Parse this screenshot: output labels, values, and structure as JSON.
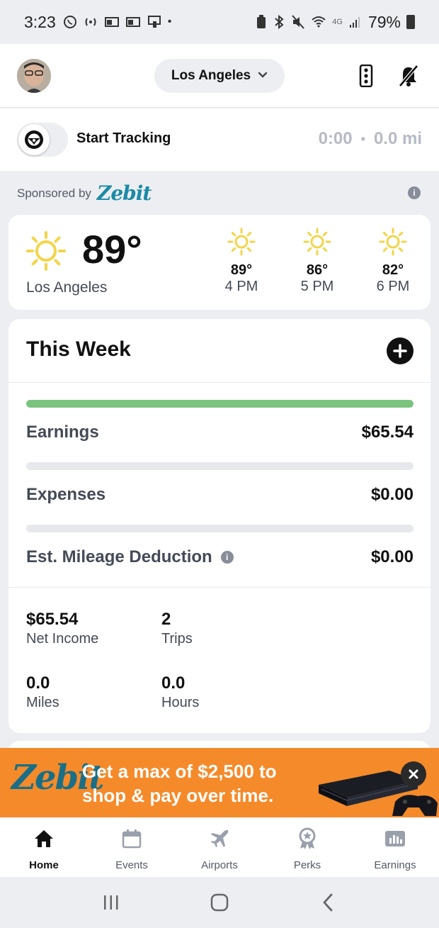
{
  "status_bar": {
    "time": "3:23",
    "network": "4G",
    "battery": "79%"
  },
  "header": {
    "city": "Los Angeles"
  },
  "tracking": {
    "label": "Start Tracking",
    "duration": "0:00",
    "separator": "•",
    "distance": "0.0 mi"
  },
  "sponsor": {
    "label": "Sponsored by",
    "brand": "Zebit"
  },
  "weather": {
    "current_temp": "89°",
    "city": "Los Angeles",
    "forecast": [
      {
        "temp": "89°",
        "hour": "4 PM"
      },
      {
        "temp": "86°",
        "hour": "5 PM"
      },
      {
        "temp": "82°",
        "hour": "6 PM"
      }
    ],
    "sun_color": "#f2d54a"
  },
  "this_week": {
    "title": "This Week",
    "earnings_progress": 1.0,
    "expenses_progress": 0,
    "mileage_progress": 0,
    "rows": {
      "earnings_label": "Earnings",
      "earnings_value": "$65.54",
      "expenses_label": "Expenses",
      "expenses_value": "$0.00",
      "mileage_label": "Est. Mileage Deduction",
      "mileage_value": "$0.00"
    },
    "stats": {
      "net_income_value": "$65.54",
      "net_income_label": "Net Income",
      "trips_value": "2",
      "trips_label": "Trips",
      "miles_value": "0.0",
      "miles_label": "Miles",
      "hours_value": "0.0",
      "hours_label": "Hours"
    },
    "accent_color": "#7bc47f"
  },
  "banner": {
    "logo": "Zebit",
    "text": "Get a max of $2,500 to shop & pay over time.",
    "bg_color": "#f58a2a"
  },
  "tabs": [
    {
      "label": "Home",
      "icon": "home-icon",
      "active": true
    },
    {
      "label": "Events",
      "icon": "calendar-icon",
      "active": false
    },
    {
      "label": "Airports",
      "icon": "airplane-icon",
      "active": false
    },
    {
      "label": "Perks",
      "icon": "award-icon",
      "active": false
    },
    {
      "label": "Earnings",
      "icon": "bar-chart-icon",
      "active": false
    }
  ]
}
